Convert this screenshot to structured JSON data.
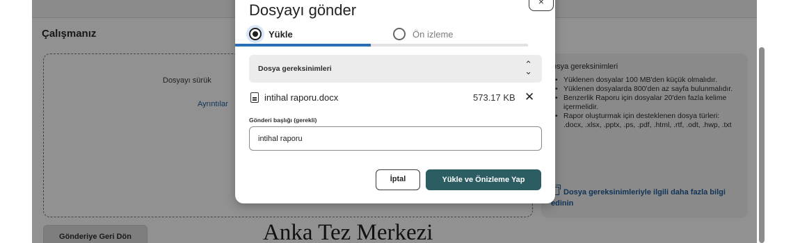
{
  "page": {
    "work_title": "Çalışmanız",
    "dropzone_text": "Dosyayı sürük",
    "dropzone_details": "Ayrıntılar",
    "back_button": "Gönderiye Geri Dön",
    "requirements_panel": {
      "title": "osya gereksinimleri",
      "items": [
        "Yüklenen dosyalar 100 MB'den küçük olmalıdır.",
        "Yüklenen dosyalarda 800'den az sayfa bulunmalıdır.",
        "Benzerlik Raporu için dosyalar 20'den fazla kelime içermelidir.",
        "Rapor oluşturmak için desteklenen dosya türleri: .docx, .xlsx, .pptx, .ps, .pdf, .html, .rtf, .odt, .hwp, .txt"
      ],
      "link": "Dosya gereksinimleriyle ilgili daha fazla bilgi edinin"
    }
  },
  "modal": {
    "title": "Dosyayı gönder",
    "close_label": "×",
    "tabs": [
      {
        "label": "Yükle",
        "selected": true
      },
      {
        "label": "Ön izleme",
        "selected": false
      }
    ],
    "accordion_label": "Dosya gereksinimleri",
    "accordion_chevron": "⌃\n⌄",
    "file": {
      "name": "intihal raporu.docx",
      "size": "573.17 KB",
      "remove_label": "✕"
    },
    "title_field": {
      "label": "Gönderi başlığı (gerekli)",
      "value": "intihal raporu"
    },
    "cancel_button": "İptal",
    "submit_button": "Yükle ve Önizleme Yap"
  },
  "watermark": "Anka Tez Merkezi",
  "colors": {
    "accent_blue": "#2a6fb6",
    "primary_button": "#2b5d63",
    "link": "#1d5b9a"
  }
}
